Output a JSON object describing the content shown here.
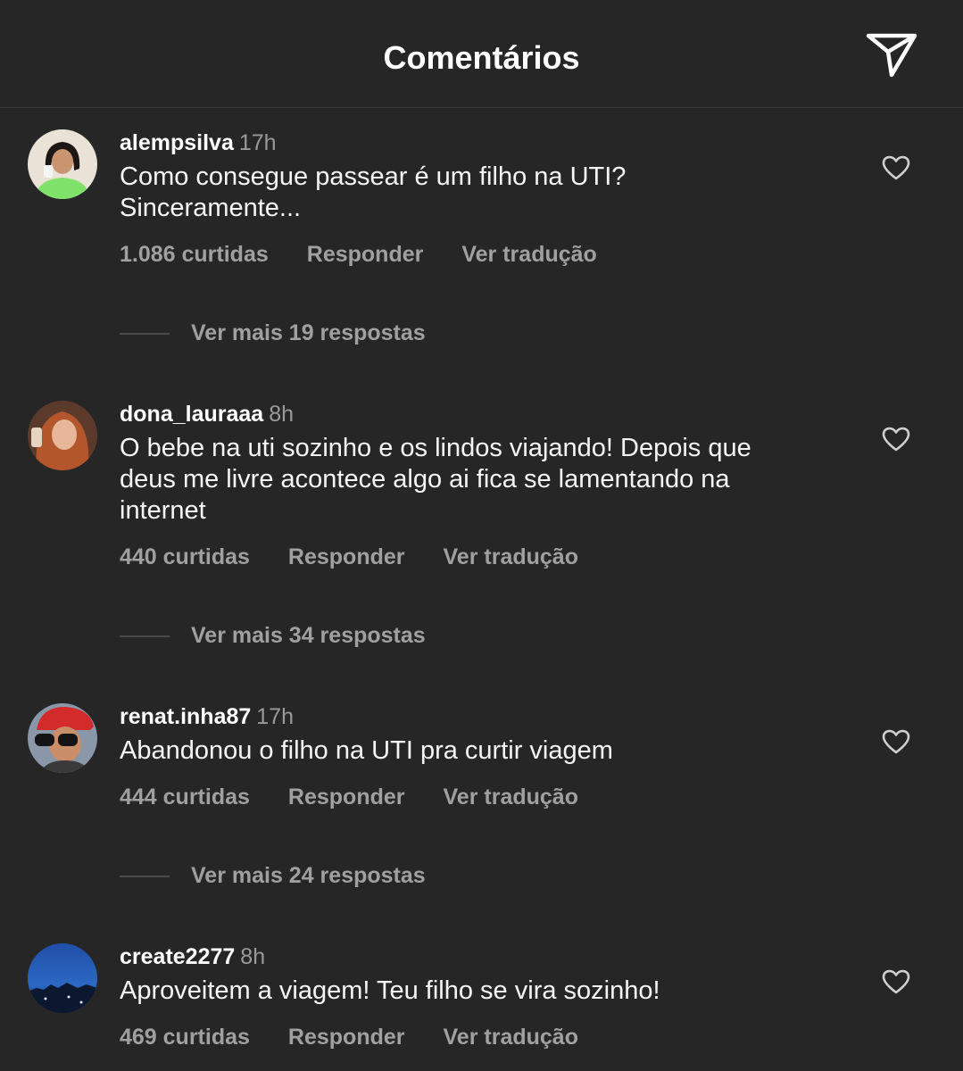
{
  "header": {
    "title": "Comentários",
    "share_icon": "paper-plane-icon"
  },
  "comments": [
    {
      "username": "alempsilva",
      "time": "17h",
      "text": [
        "Como consegue passear é um filho na UTI?",
        "Sinceramente..."
      ],
      "likes": "1.086 curtidas",
      "reply": "Responder",
      "translate": "Ver tradução",
      "more_replies": "Ver mais 19 respostas"
    },
    {
      "username": "dona_lauraaa",
      "time": "8h",
      "text": [
        "O bebe na uti sozinho e os lindos viajando! Depois que",
        "deus me livre acontece algo ai fica se lamentando na",
        "internet"
      ],
      "likes": "440 curtidas",
      "reply": "Responder",
      "translate": "Ver tradução",
      "more_replies": "Ver mais 34 respostas"
    },
    {
      "username": "renat.inha87",
      "time": "17h",
      "text": [
        "Abandonou o filho na UTI pra curtir viagem"
      ],
      "likes": "444 curtidas",
      "reply": "Responder",
      "translate": "Ver tradução",
      "more_replies": "Ver mais 24 respostas"
    },
    {
      "username": "create2277",
      "time": "8h",
      "text": [
        "Aproveitem a viagem! Teu filho se vira sozinho!"
      ],
      "likes": "469 curtidas",
      "reply": "Responder",
      "translate": "Ver tradução"
    }
  ],
  "colors": {
    "background": "#262626",
    "secondary_text": "#a0a0a0"
  }
}
